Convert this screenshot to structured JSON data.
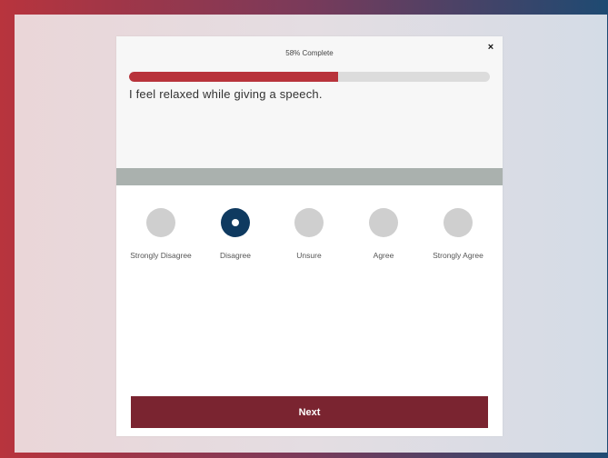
{
  "progress": {
    "label": "58% Complete",
    "percent": 58
  },
  "close": {
    "label": "×",
    "icon": "close-icon"
  },
  "question": {
    "text": "I feel relaxed while giving a speech."
  },
  "options": [
    {
      "label": "Strongly Disagree",
      "selected": false
    },
    {
      "label": "Disagree",
      "selected": true
    },
    {
      "label": "Unsure",
      "selected": false
    },
    {
      "label": "Agree",
      "selected": false
    },
    {
      "label": "Strongly Agree",
      "selected": false
    }
  ],
  "next": {
    "label": "Next"
  },
  "colors": {
    "progress_fill": "#b8333b",
    "selected_radio": "#0f3a60",
    "unselected_radio": "#cfcfcf",
    "next_button": "#7a2430",
    "divider_band": "#aab1ae"
  }
}
